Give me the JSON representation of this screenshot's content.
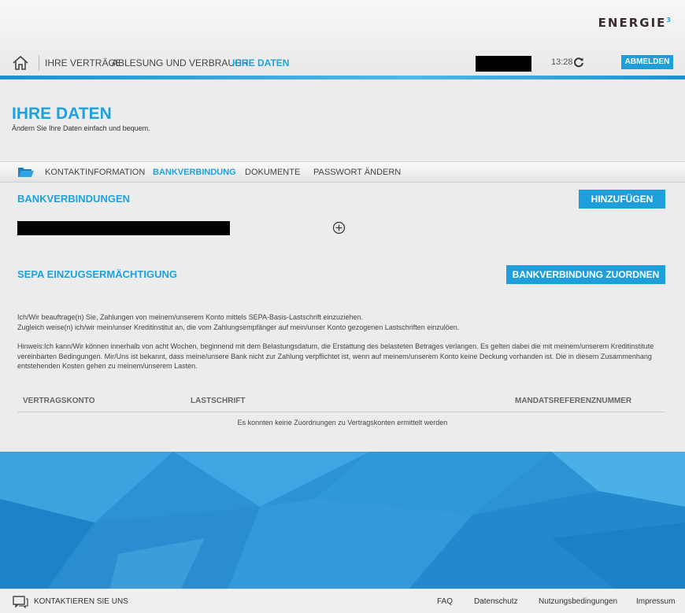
{
  "header": {
    "logo_text": "ENERGIE",
    "logo_sup": "3",
    "nav": {
      "contracts": "IHRE VERTRÄGE",
      "reading": "ABLESUNG UND VERBRAUCH",
      "data": "IHRE DATEN"
    },
    "time": "13:28",
    "logout_label": "ABMELDEN"
  },
  "page": {
    "title": "IHRE DATEN",
    "subtitle": "Ändern Sie Ihre Daten einfach und bequem."
  },
  "tabs": [
    {
      "label": "KONTAKTINFORMATION"
    },
    {
      "label": "BANKVERBINDUNG"
    },
    {
      "label": "DOKUMENTE"
    },
    {
      "label": "PASSWORT ÄNDERN"
    }
  ],
  "bank": {
    "title": "BANKVERBINDUNGEN",
    "add_label": "HINZUFÜGEN"
  },
  "sepa": {
    "title": "SEPA EINZUGSERMÄCHTIGUNG",
    "assign_label": "BANKVERBINDUNG ZUORDNEN",
    "para1_line1": "Ich/Wir beauftrage(n) Sie, Zahlungen von meinem/unserem Konto mittels SEPA-Basis-Lastschrift einzuziehen.",
    "para1_line2": "Zugleich weise(n) ich/wir mein/unser Kreditinstitut an, die vom Zahlungsempfänger auf mein/unser Konto gezogenen Lastschriften einzulöen.",
    "para2": "Hinweis:Ich kann/Wir können innerhalb von acht Wochen, beginnend mit dem Belastungsdatum, die Erstattung des belasteten Betrages verlangen. Es gelten dabei die mit meinem/unserem Kreditinstitute vereinbarten Bedingungen. Mir/Uns ist bekannt, dass meine/unsere Bank nicht zur Zahlung verpflichtet ist, wenn auf meinem/unserem Konto keine Deckung vorhanden ist. Die in diesem Zusammenhang entstehenden Kosten gehen zu meinem/unserem Lasten."
  },
  "table": {
    "columns": [
      "VERTRAGSKONTO",
      "LASTSCHRIFT",
      "MANDATSREFERENZNUMMER"
    ],
    "empty_message": "Es konnten keine Zuordnungen zu Vertragskonten ermittelt werden"
  },
  "footer": {
    "contact": "KONTAKTIEREN SIE UNS",
    "faq": "FAQ",
    "privacy": "Datenschutz",
    "terms": "Nutzungsbedingungen",
    "imprint": "Impressum"
  },
  "colors": {
    "accent": "#1ea2de",
    "button": "#1e9fdc",
    "banner": "#2a8fd0"
  },
  "icons": [
    "home-icon",
    "refresh-icon",
    "folder-icon",
    "plus-circle-icon",
    "chat-icon"
  ]
}
